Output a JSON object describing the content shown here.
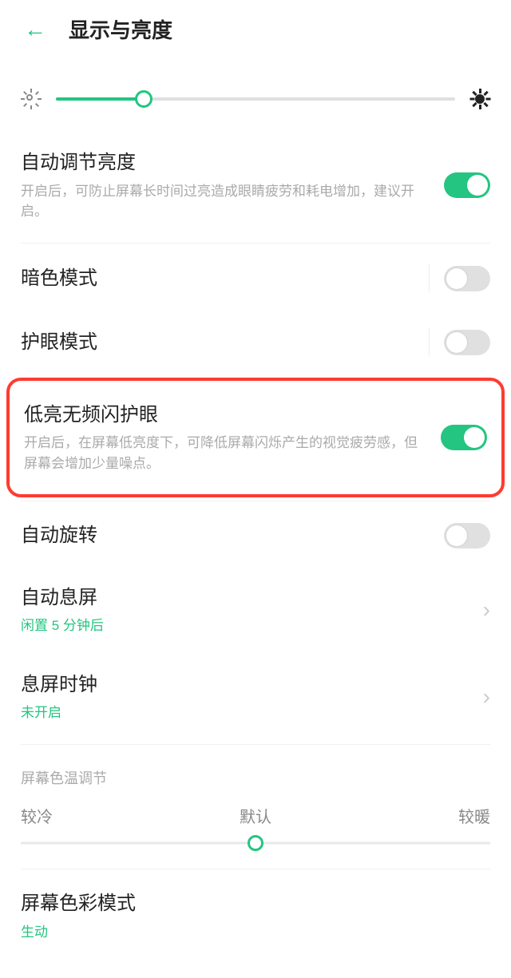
{
  "header": {
    "title": "显示与亮度"
  },
  "brightness": {
    "percent": 22
  },
  "rows": {
    "autoBrightness": {
      "title": "自动调节亮度",
      "sub": "开启后，可防止屏幕长时间过亮造成眼睛疲劳和耗电增加，建议开启。",
      "on": true
    },
    "darkMode": {
      "title": "暗色模式",
      "on": false
    },
    "eyeCare": {
      "title": "护眼模式",
      "on": false
    },
    "lowFlicker": {
      "title": "低亮无频闪护眼",
      "sub": "开启后，在屏幕低亮度下，可降低屏幕闪烁产生的视觉疲劳感，但屏幕会增加少量噪点。",
      "on": true
    },
    "autoRotate": {
      "title": "自动旋转",
      "on": false
    },
    "autoLock": {
      "title": "自动息屏",
      "sub": "闲置 5 分钟后"
    },
    "aodClock": {
      "title": "息屏时钟",
      "sub": "未开启"
    }
  },
  "colorTemp": {
    "section": "屏幕色温调节",
    "cold": "较冷",
    "default": "默认",
    "warm": "较暖"
  },
  "colorMode": {
    "title": "屏幕色彩模式",
    "sub": "生动"
  }
}
